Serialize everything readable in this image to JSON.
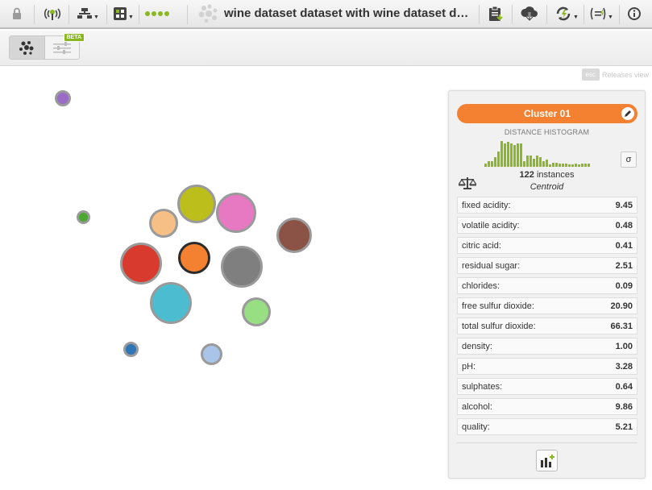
{
  "toolbar": {
    "title": "wine dataset dataset with wine dataset datas...",
    "icons": [
      "lock-icon",
      "antenna-icon",
      "model-tree-icon",
      "batch-icon",
      "progress-dots",
      "cluster-logo-icon",
      "clipboard-download-icon",
      "cloud-download-icon",
      "refresh-bolt-icon",
      "formula-icon",
      "info-icon"
    ],
    "accent_color": "#8ab820"
  },
  "subbar": {
    "beta_label": "BETA"
  },
  "hint": {
    "esc_label": "esc",
    "releases_label": "Releases view"
  },
  "clusters": [
    {
      "color": "#9b6bc8"
    },
    {
      "color": "#4ca832"
    },
    {
      "color": "#f6bf86"
    },
    {
      "color": "#bcbe1c"
    },
    {
      "color": "#e778c2"
    },
    {
      "color": "#8b5246"
    },
    {
      "color": "#d93a2e"
    },
    {
      "color": "#f38131",
      "selected": true
    },
    {
      "color": "#7f7f7f"
    },
    {
      "color": "#4cbdd0"
    },
    {
      "color": "#98de83"
    },
    {
      "color": "#2e76b6"
    },
    {
      "color": "#a9c4e8"
    }
  ],
  "panel": {
    "cluster_name": "Cluster 01",
    "header_color": "#f38131",
    "histogram_title": "DISTANCE HISTOGRAM",
    "histogram": [
      0.12,
      0.2,
      0.2,
      0.35,
      0.55,
      0.95,
      0.85,
      0.9,
      0.85,
      0.8,
      0.85,
      0.85,
      0.2,
      0.4,
      0.4,
      0.3,
      0.4,
      0.35,
      0.2,
      0.25,
      0.1,
      0.15,
      0.15,
      0.12,
      0.12,
      0.12,
      0.1,
      0.1,
      0.12,
      0.1,
      0.12,
      0.12,
      0.12
    ],
    "sigma_label": "σ",
    "instances_count": "122",
    "instances_label": "instances",
    "centroid_label": "Centroid",
    "features": [
      {
        "name": "fixed acidity:",
        "value": "9.45"
      },
      {
        "name": "volatile acidity:",
        "value": "0.48"
      },
      {
        "name": "citric acid:",
        "value": "0.41"
      },
      {
        "name": "residual sugar:",
        "value": "2.51"
      },
      {
        "name": "chlorides:",
        "value": "0.09"
      },
      {
        "name": "free sulfur dioxide:",
        "value": "20.90"
      },
      {
        "name": "total sulfur dioxide:",
        "value": "66.31"
      },
      {
        "name": "density:",
        "value": "1.00"
      },
      {
        "name": "pH:",
        "value": "3.28"
      },
      {
        "name": "sulphates:",
        "value": "0.64"
      },
      {
        "name": "alcohol:",
        "value": "9.86"
      },
      {
        "name": "quality:",
        "value": "5.21"
      }
    ]
  }
}
